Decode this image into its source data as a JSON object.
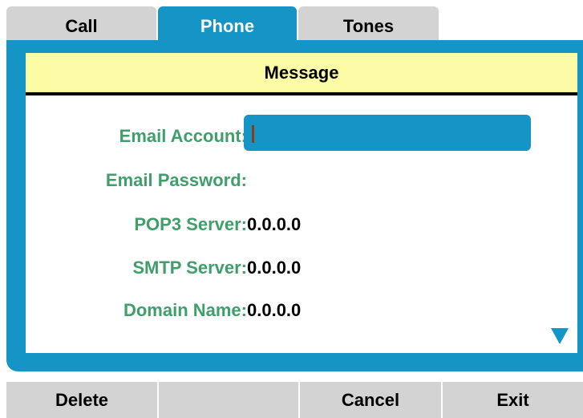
{
  "tabs": [
    {
      "label": "Call",
      "active": false
    },
    {
      "label": "Phone",
      "active": true
    },
    {
      "label": "Tones",
      "active": false
    }
  ],
  "panel": {
    "title": "Message"
  },
  "fields": {
    "email_account": {
      "label": "Email Account:",
      "value": ""
    },
    "email_password": {
      "label": "Email Password:",
      "value": ""
    },
    "pop3_server": {
      "label": "POP3 Server:",
      "value": "0.0.0.0"
    },
    "smtp_server": {
      "label": "SMTP Server:",
      "value": "0.0.0.0"
    },
    "domain_name": {
      "label": "Domain Name:",
      "value": "0.0.0.0"
    }
  },
  "scroll": {
    "icon": "triangle-down-icon",
    "more_below": true
  },
  "softkeys": [
    "Delete",
    "",
    "Cancel",
    "Exit"
  ],
  "colors": {
    "accent_blue": "#1595c6",
    "header_yellow": "#fdfca6",
    "label_green": "#3f9e6a",
    "tab_gray": "#d3d3d3",
    "caret_brown": "#8b3a1a"
  }
}
